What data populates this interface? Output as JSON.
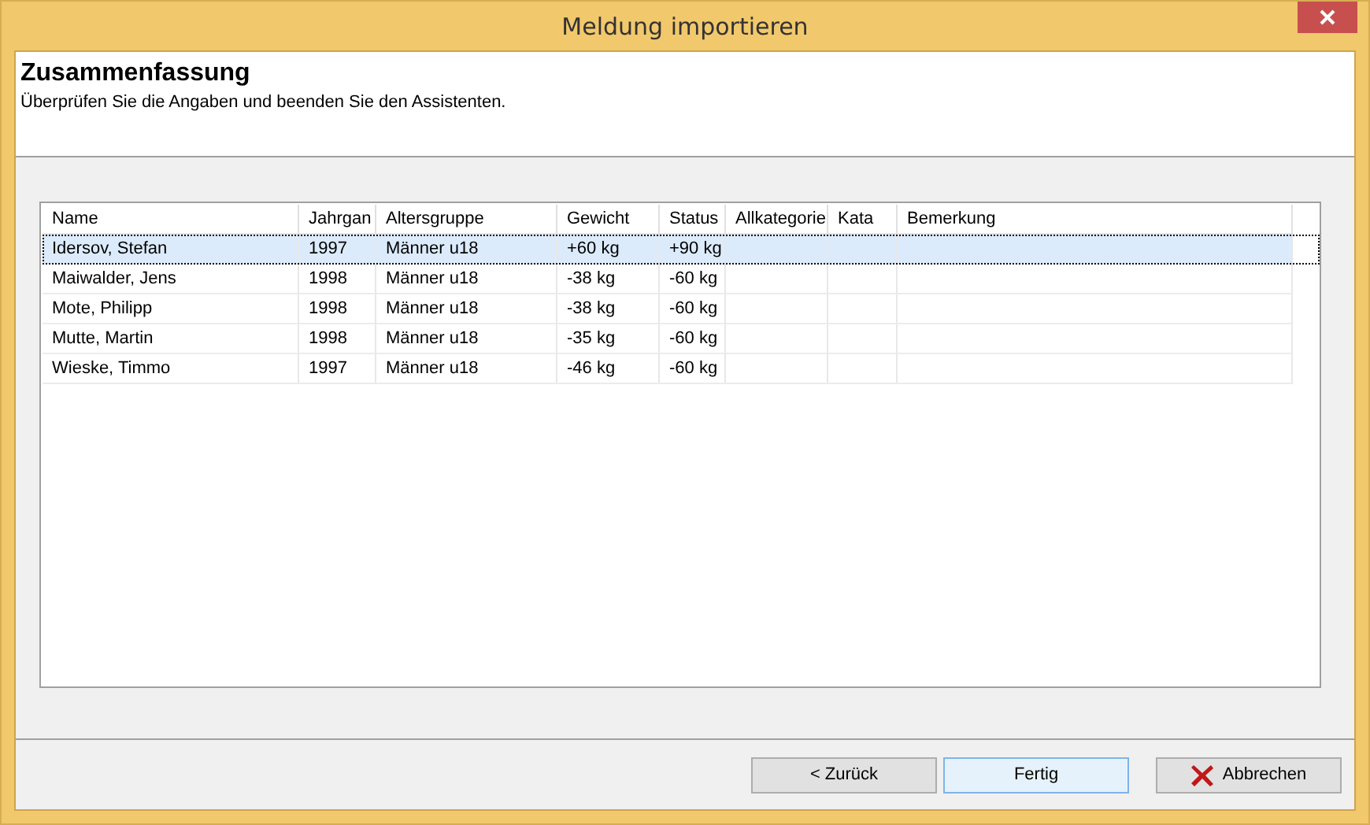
{
  "window": {
    "title": "Meldung importieren"
  },
  "header": {
    "title": "Zusammenfassung",
    "subtitle": "Überprüfen Sie die Angaben und beenden Sie den Assistenten."
  },
  "table": {
    "columns": [
      "Name",
      "Jahrgan",
      "Altersgruppe",
      "Gewicht",
      "Status",
      "Allkategorie",
      "Kata",
      "Bemerkung"
    ],
    "rows": [
      {
        "selected": true,
        "cells": [
          "Idersov, Stefan",
          "1997",
          "Männer u18",
          "+60 kg",
          "+90 kg",
          "",
          "",
          ""
        ]
      },
      {
        "selected": false,
        "cells": [
          "Maiwalder, Jens",
          "1998",
          "Männer u18",
          "-38 kg",
          "-60 kg",
          "",
          "",
          ""
        ]
      },
      {
        "selected": false,
        "cells": [
          "Mote, Philipp",
          "1998",
          "Männer u18",
          "-38 kg",
          "-60 kg",
          "",
          "",
          ""
        ]
      },
      {
        "selected": false,
        "cells": [
          "Mutte, Martin",
          "1998",
          "Männer u18",
          "-35 kg",
          "-60 kg",
          "",
          "",
          ""
        ]
      },
      {
        "selected": false,
        "cells": [
          "Wieske, Timmo",
          "1997",
          "Männer u18",
          "-46 kg",
          "-60 kg",
          "",
          "",
          ""
        ]
      }
    ]
  },
  "buttons": [
    {
      "label": "< Zurück",
      "kind": "back",
      "focused": false
    },
    {
      "label": "Fertig",
      "kind": "finish",
      "focused": true
    },
    {
      "label": "Abbrechen",
      "kind": "cancel",
      "focused": false
    }
  ]
}
